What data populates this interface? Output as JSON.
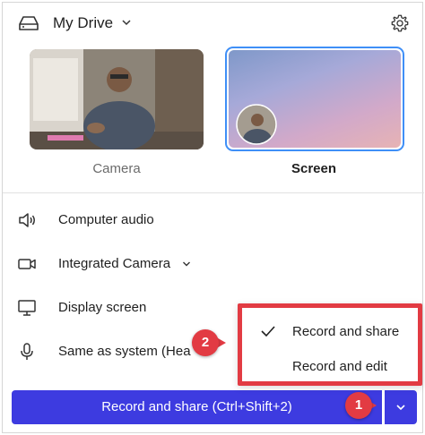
{
  "header": {
    "drive_label": "My Drive",
    "drive_icon": "drive-icon",
    "settings_icon": "gear-icon"
  },
  "sources": [
    {
      "label": "Camera",
      "selected": false
    },
    {
      "label": "Screen",
      "selected": true
    }
  ],
  "options": [
    {
      "label": "Computer audio",
      "icon": "speaker-icon"
    },
    {
      "label": "Integrated Camera",
      "icon": "camera-icon",
      "has_dropdown": true
    },
    {
      "label": "Display screen",
      "icon": "monitor-icon"
    },
    {
      "label": "Same as system (Hea",
      "icon": "microphone-icon"
    }
  ],
  "record": {
    "label": "Record and share (Ctrl+Shift+2)",
    "dropdown_icon": "chevron-down-icon"
  },
  "menu": {
    "items": [
      {
        "label": "Record and share",
        "checked": true
      },
      {
        "label": "Record and edit",
        "checked": false
      }
    ]
  },
  "callouts": {
    "first": "1",
    "second": "2"
  },
  "colors": {
    "primary": "#3d3be0",
    "selection_border": "#3f8ff7",
    "annotation": "#e23b43"
  }
}
